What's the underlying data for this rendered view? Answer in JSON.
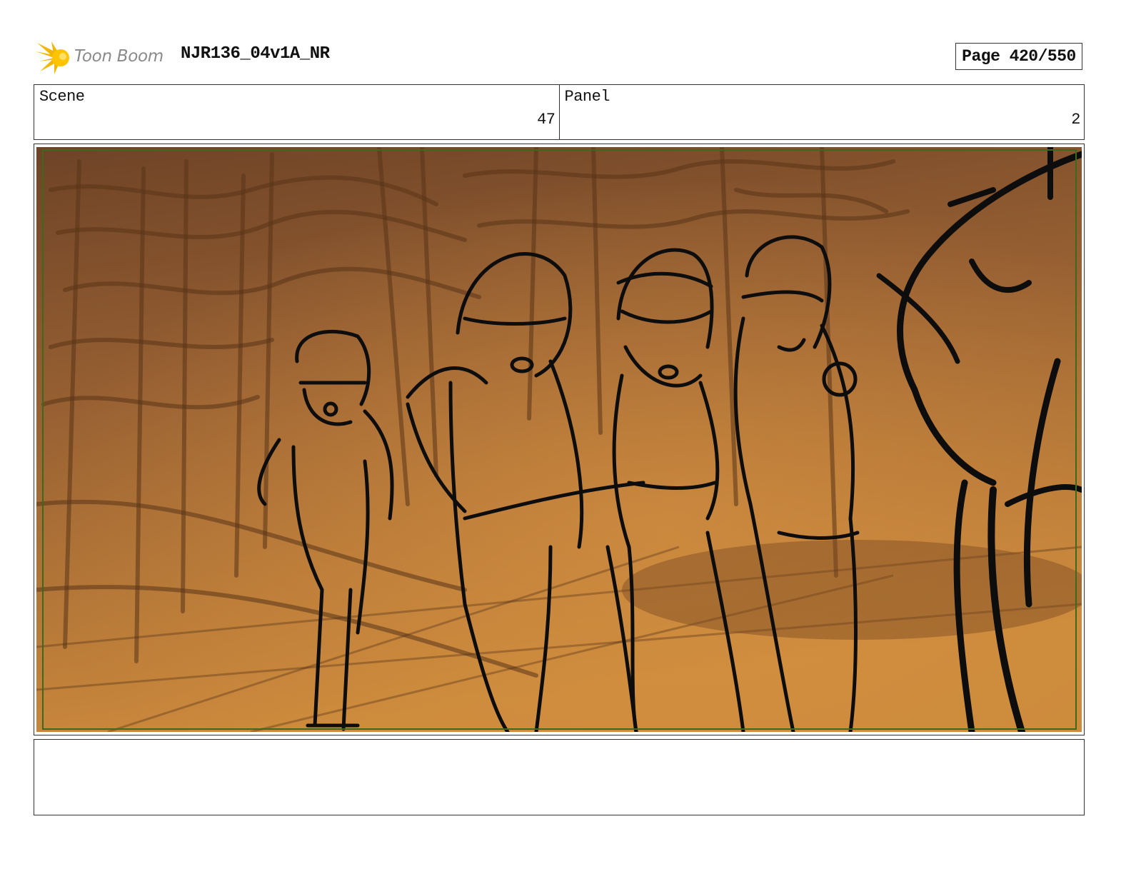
{
  "header": {
    "brand": "Toon Boom",
    "title": "NJR136_04v1A_NR",
    "page": "Page 420/550"
  },
  "info": {
    "scene_label": "Scene",
    "scene_value": "47",
    "panel_label": "Panel",
    "panel_value": "2"
  },
  "panel_image": {
    "icon": "storyboard-sketch",
    "colors": {
      "sky_top": "#7a4a28",
      "sky_mid": "#a86a34",
      "ground": "#c9883f",
      "ink": "#111111",
      "safe_frame": "#3b6a1c"
    }
  },
  "notes": {
    "text": ""
  }
}
